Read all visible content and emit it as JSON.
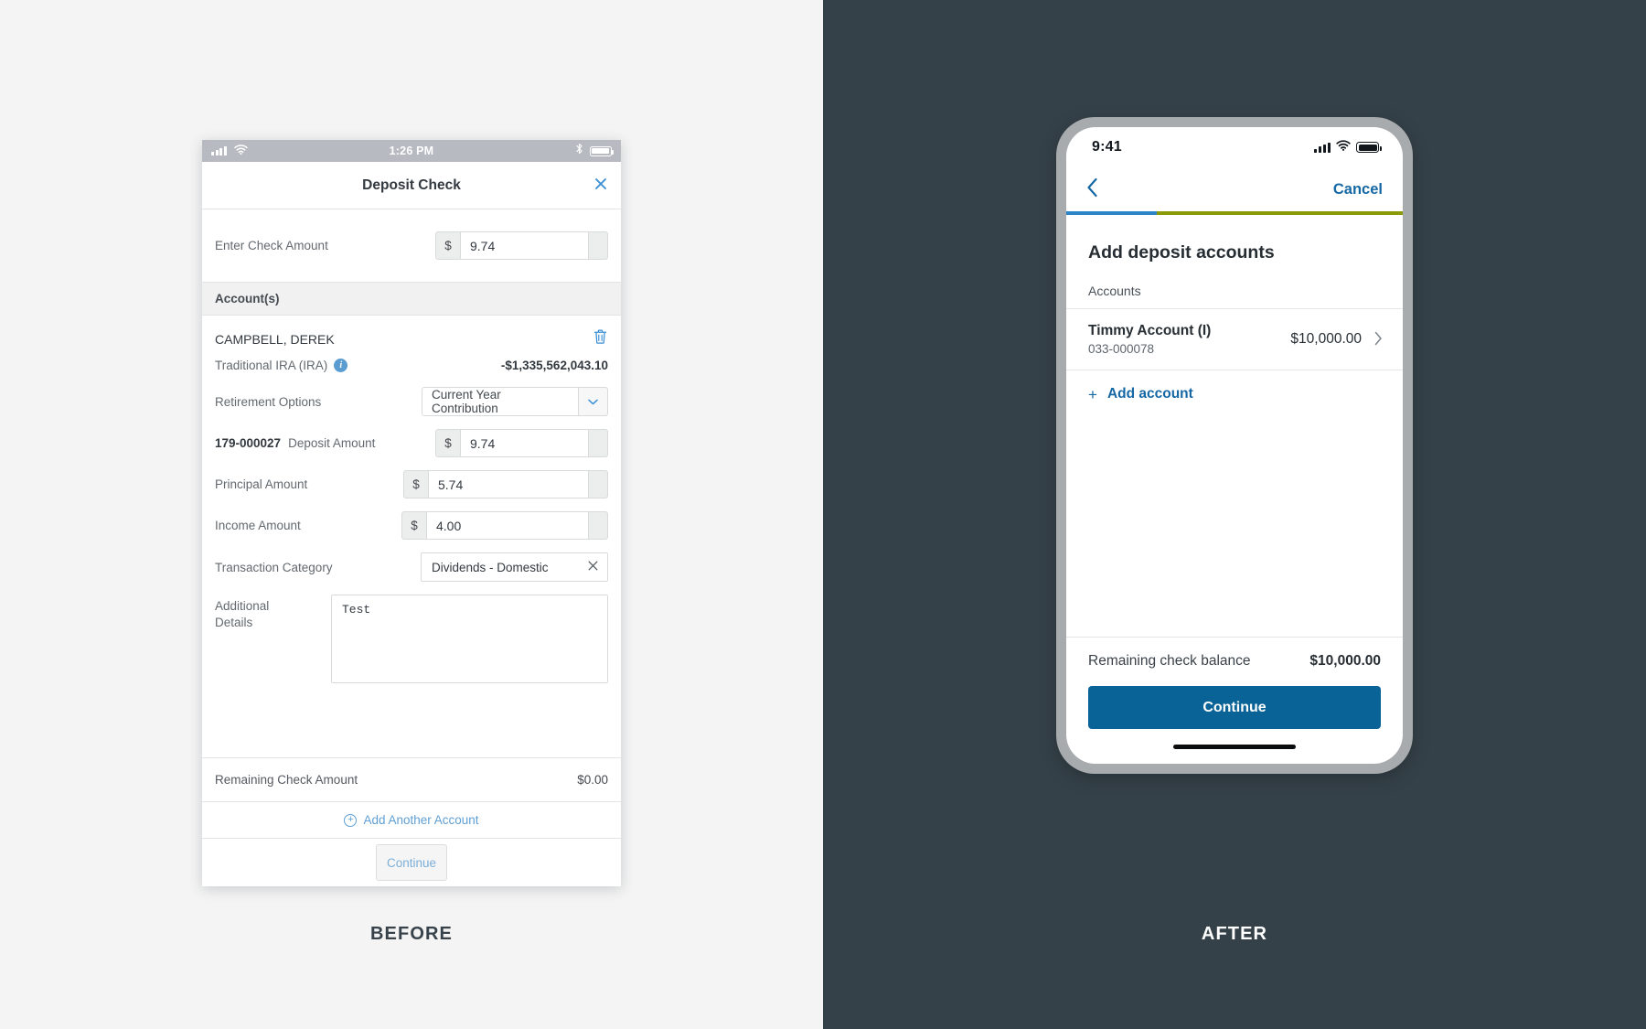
{
  "comparison": {
    "before_label": "BEFORE",
    "after_label": "AFTER"
  },
  "before": {
    "status_bar": {
      "time": "1:26 PM",
      "signal_icon": "cellular-bars-icon",
      "wifi_icon": "wifi-icon",
      "bluetooth_icon": "bluetooth-icon",
      "battery_icon": "battery-icon"
    },
    "modal": {
      "title": "Deposit Check",
      "close_icon": "close-icon"
    },
    "check_amount": {
      "label": "Enter Check Amount",
      "currency_symbol": "$",
      "value": "9.74"
    },
    "accounts_section_header": "Account(s)",
    "account": {
      "owner_name": "CAMPBELL, DEREK",
      "delete_icon": "trash-icon",
      "account_type": "Traditional IRA (IRA)",
      "info_icon": "info-icon",
      "info_glyph": "i",
      "balance": "-$1,335,562,043.10",
      "retirement_options_label": "Retirement Options",
      "retirement_options_value": "Current Year Contribution",
      "retirement_options_caret": "chevron-down-icon",
      "account_number": "179-000027",
      "deposit_amount_label": "Deposit Amount",
      "deposit_amount_currency": "$",
      "deposit_amount_value": "9.74",
      "principal_amount_label": "Principal Amount",
      "principal_amount_currency": "$",
      "principal_amount_value": "5.74",
      "income_amount_label": "Income Amount",
      "income_amount_currency": "$",
      "income_amount_value": "4.00",
      "transaction_category_label": "Transaction Category",
      "transaction_category_value": "Dividends - Domestic",
      "transaction_category_clear": "×",
      "additional_details_label": "Additional Details",
      "additional_details_value": "Test"
    },
    "footer": {
      "remaining_label": "Remaining Check Amount",
      "remaining_value": "$0.00",
      "add_another_label": "Add Another Account",
      "add_another_icon": "plus-circle-icon",
      "continue_label": "Continue"
    }
  },
  "after": {
    "status_bar": {
      "time": "9:41",
      "signal_icon": "cellular-bars-icon",
      "wifi_icon": "wifi-icon",
      "battery_icon": "battery-icon"
    },
    "nav": {
      "back_icon": "chevron-left-icon",
      "back_glyph": "‹",
      "cancel_label": "Cancel"
    },
    "progress": {
      "completed_percent": 27,
      "completed_color": "#2a84c8",
      "remaining_color": "#8a9a06"
    },
    "page_title": "Add deposit accounts",
    "list_label": "Accounts",
    "account_row": {
      "name": "Timmy Account (I)",
      "number": "033-000078",
      "amount": "$10,000.00",
      "chevron_icon": "chevron-right-icon",
      "chevron_glyph": "›"
    },
    "add_account": {
      "icon": "plus-icon",
      "glyph": "+",
      "label": "Add account"
    },
    "balance": {
      "label": "Remaining check balance",
      "value": "$10,000.00"
    },
    "continue_label": "Continue",
    "home_indicator": "home-indicator"
  }
}
